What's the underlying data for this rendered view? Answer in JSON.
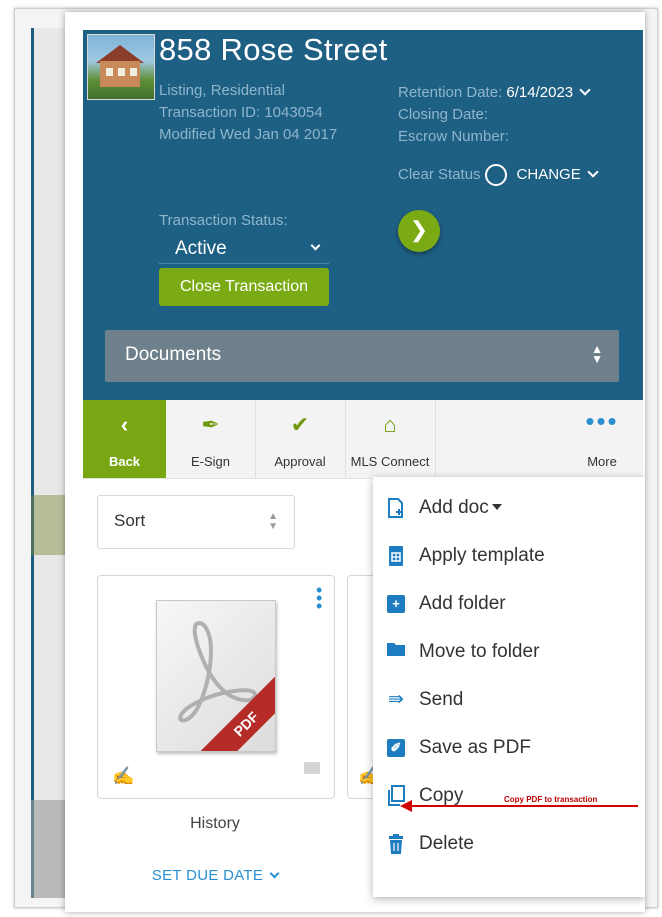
{
  "header": {
    "address": "858 Rose Street",
    "listing_type": "Listing, Residential",
    "transaction_id": "Transaction ID: 1043054",
    "modified": "Modified Wed Jan 04 2017",
    "retention_label": "Retention Date:",
    "retention_value": "6/14/2023",
    "closing_date_label": "Closing Date:",
    "escrow_label": "Escrow Number:",
    "clear_status_label": "Clear Status",
    "change_label": "CHANGE",
    "go_icon": "chevron-right-icon",
    "transaction_status_label": "Transaction Status:",
    "transaction_status_value": "Active",
    "close_transaction_label": "Close Transaction",
    "documents_label": "Documents"
  },
  "toolbar": {
    "items": [
      {
        "label": "Back",
        "icon": "chevron-left-icon"
      },
      {
        "label": "E-Sign",
        "icon": "pen-icon"
      },
      {
        "label": "Approval",
        "icon": "check-circle-icon"
      },
      {
        "label": "MLS Connect",
        "icon": "house-icon"
      },
      {
        "label": "More",
        "icon": "ellipsis-icon"
      }
    ]
  },
  "content": {
    "sort_label": "Sort",
    "card_name": "History",
    "card_badge": "PDF",
    "set_due_date_label": "SET DUE DATE"
  },
  "menu": {
    "items": [
      {
        "label": "Add doc",
        "icon": "add-document-icon"
      },
      {
        "label": "Apply template",
        "icon": "template-icon"
      },
      {
        "label": "Add folder",
        "icon": "add-folder-icon"
      },
      {
        "label": "Move to folder",
        "icon": "folder-icon"
      },
      {
        "label": "Send",
        "icon": "send-arrow-icon"
      },
      {
        "label": "Save as PDF",
        "icon": "pdf-icon"
      },
      {
        "label": "Copy",
        "icon": "copy-icon"
      },
      {
        "label": "Delete",
        "icon": "trash-icon"
      }
    ]
  },
  "annotation": {
    "text": "Copy PDF to transaction"
  },
  "colors": {
    "header_bg": "#1e5f84",
    "accent_green": "#7bab14",
    "link_blue": "#2a8fd0",
    "annotation_red": "#d00000"
  }
}
